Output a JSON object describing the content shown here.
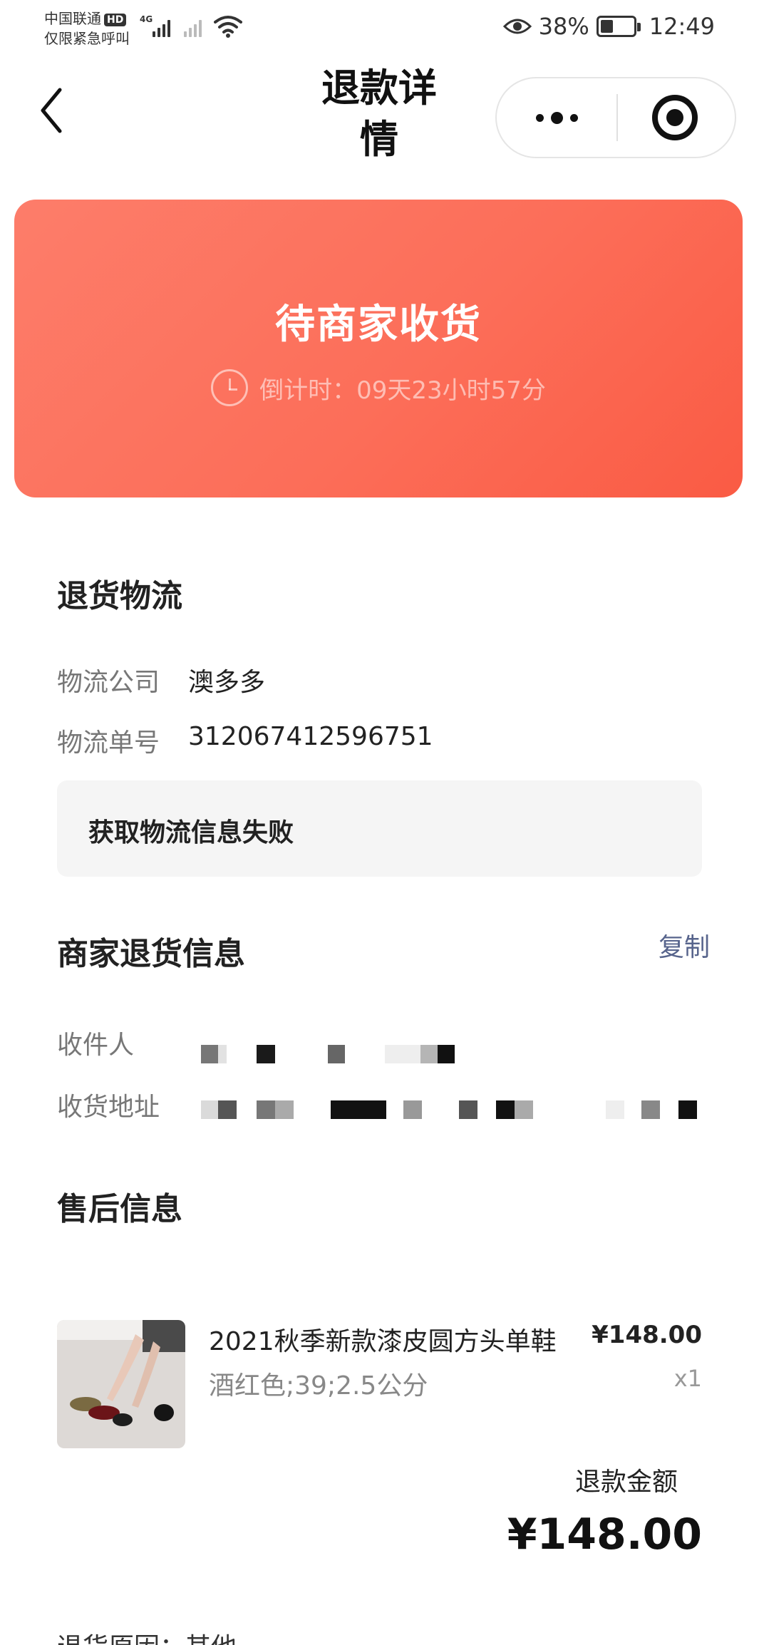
{
  "status_bar": {
    "carrier": "中国联通",
    "hd": "HD",
    "emergency": "仅限紧急呼叫",
    "network": "4G",
    "battery": "38%",
    "battery_level": 0.38,
    "time": "12:49"
  },
  "nav": {
    "title_line1": "退款详",
    "title_line2": "情"
  },
  "banner": {
    "status": "待商家收货",
    "countdown": "倒计时：09天23小时57分"
  },
  "logistics": {
    "title": "退货物流",
    "company_label": "物流公司",
    "company_value": "澳多多",
    "tracking_label": "物流单号",
    "tracking_value": "312067412596751",
    "error": "获取物流信息失败"
  },
  "merchant": {
    "title": "商家退货信息",
    "copy": "复制",
    "recipient_label": "收件人",
    "address_label": "收货地址"
  },
  "after_sale": {
    "title": "售后信息",
    "product_name": "2021秋季新款漆皮圆方头单鞋",
    "product_spec": "酒红色;39;2.5公分",
    "price": "¥148.00",
    "quantity": "x1",
    "refund_label": "退款金额",
    "refund_amount": "¥148.00"
  },
  "footer_cutoff": "退货原因：其他"
}
